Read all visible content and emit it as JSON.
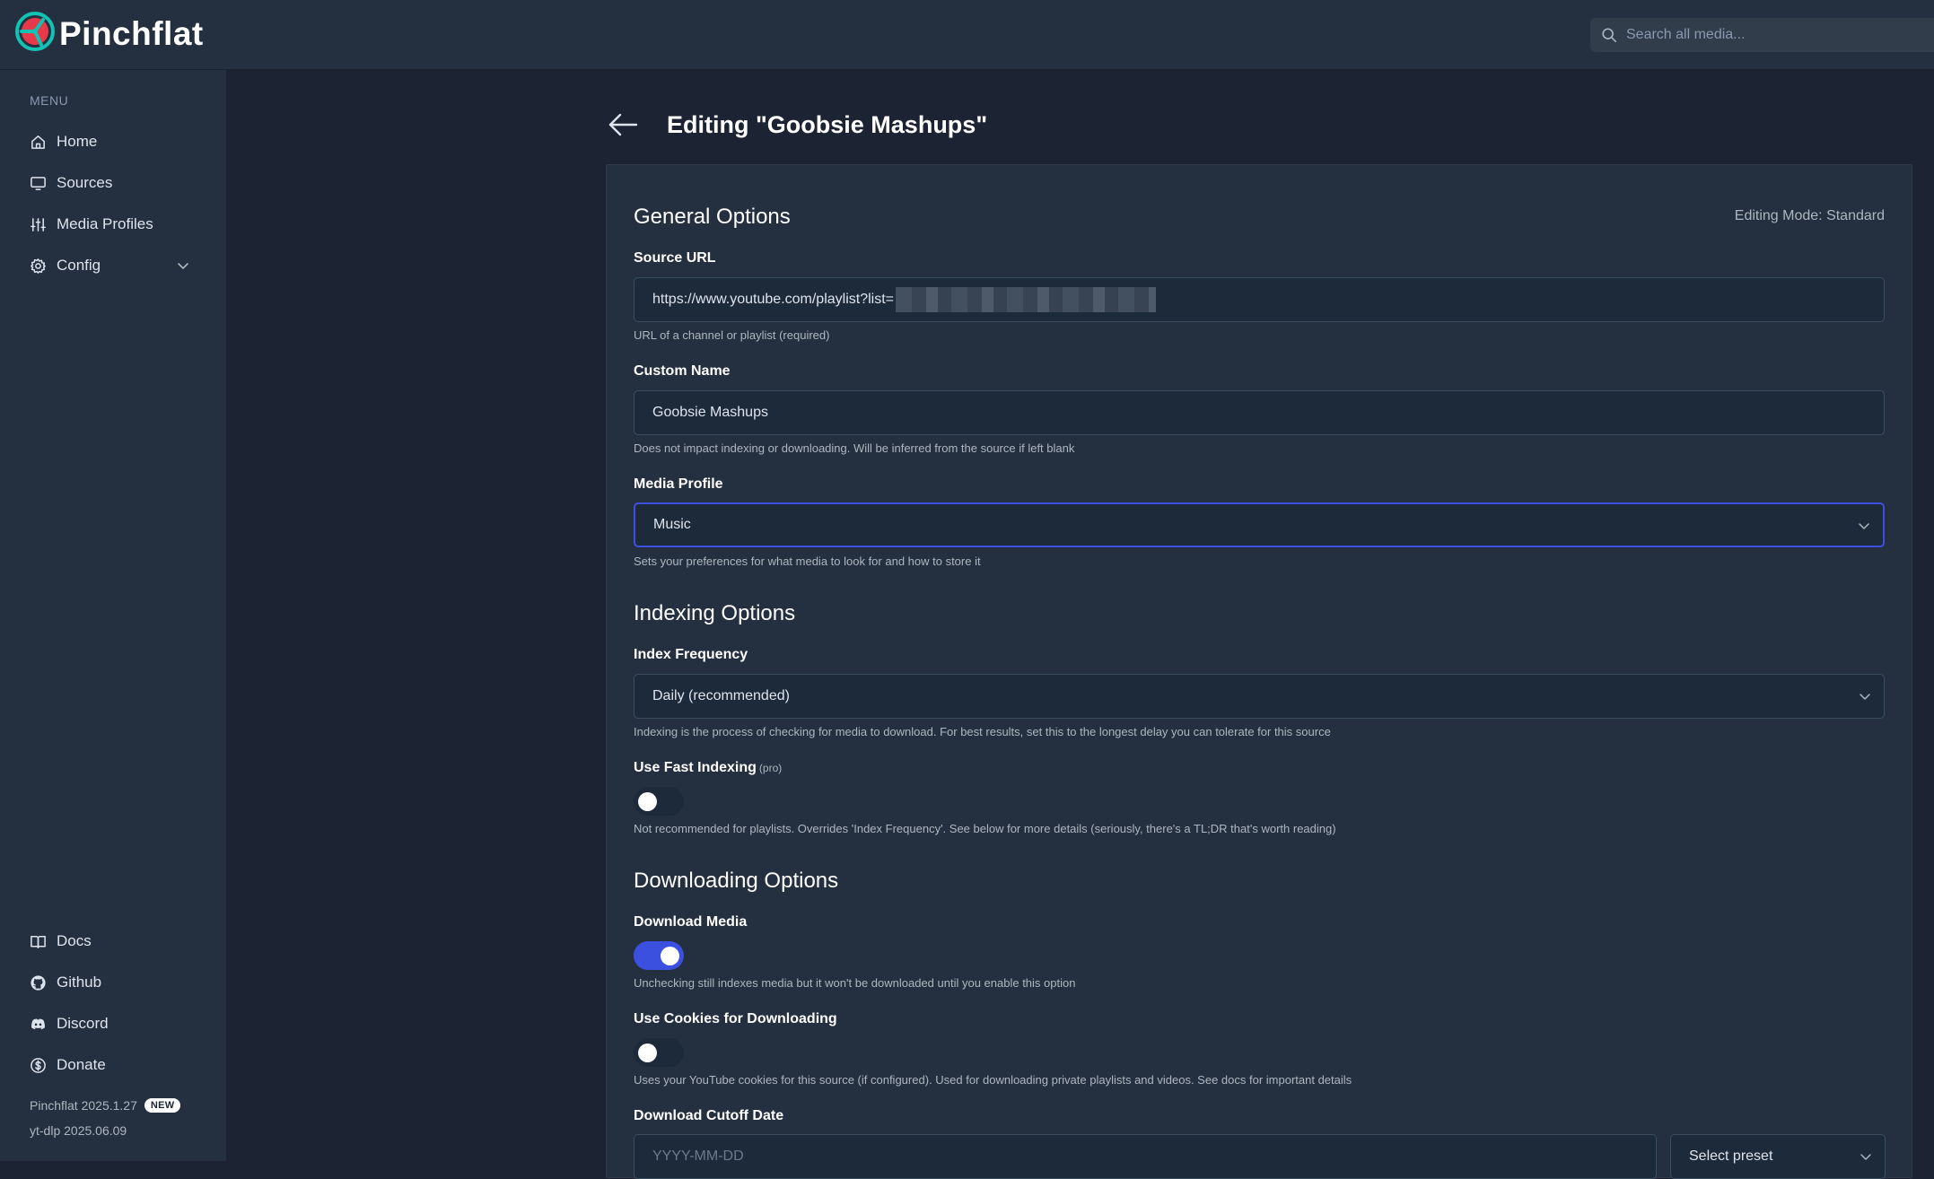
{
  "app": {
    "name": "Pinchflat",
    "search_placeholder": "Search all media..."
  },
  "sidebar": {
    "menu_label": "MENU",
    "items": [
      {
        "label": "Home",
        "icon": "home-icon"
      },
      {
        "label": "Sources",
        "icon": "monitor-icon"
      },
      {
        "label": "Media Profiles",
        "icon": "sliders-icon"
      },
      {
        "label": "Config",
        "icon": "gear-icon"
      }
    ],
    "bottom_items": [
      {
        "label": "Docs",
        "icon": "book-icon"
      },
      {
        "label": "Github",
        "icon": "github-icon"
      },
      {
        "label": "Discord",
        "icon": "discord-icon"
      },
      {
        "label": "Donate",
        "icon": "dollar-icon"
      }
    ],
    "version": "Pinchflat 2025.1.27",
    "new_badge": "NEW",
    "ytdlp_version": "yt-dlp 2025.06.09"
  },
  "page": {
    "title": "Editing \"Goobsie Mashups\""
  },
  "form": {
    "editing_mode": "Editing Mode: Standard",
    "general": {
      "title": "General Options",
      "source_url_label": "Source URL",
      "source_url_value": "https://www.youtube.com/playlist?list=",
      "source_url_hint": "URL of a channel or playlist (required)",
      "custom_name_label": "Custom Name",
      "custom_name_value": "Goobsie Mashups",
      "custom_name_hint": "Does not impact indexing or downloading. Will be inferred from the source if left blank",
      "media_profile_label": "Media Profile",
      "media_profile_value": "Music",
      "media_profile_hint": "Sets your preferences for what media to look for and how to store it"
    },
    "indexing": {
      "title": "Indexing Options",
      "frequency_label": "Index Frequency",
      "frequency_value": "Daily (recommended)",
      "frequency_hint": "Indexing is the process of checking for media to download. For best results, set this to the longest delay you can tolerate for this source",
      "fast_label": "Use Fast Indexing",
      "fast_pro": "(pro)",
      "fast_enabled": false,
      "fast_hint": "Not recommended for playlists. Overrides 'Index Frequency'. See below for more details (seriously, there's a TL;DR that's worth reading)"
    },
    "downloading": {
      "title": "Downloading Options",
      "download_label": "Download Media",
      "download_enabled": true,
      "download_hint": "Unchecking still indexes media but it won't be downloaded until you enable this option",
      "cookies_label": "Use Cookies for Downloading",
      "cookies_enabled": false,
      "cookies_hint": "Uses your YouTube cookies for this source (if configured). Used for downloading private playlists and videos. See docs for important details",
      "cutoff_label": "Download Cutoff Date",
      "cutoff_placeholder": "YYYY-MM-DD",
      "preset_value": "Select preset"
    }
  },
  "colors": {
    "accent": "#3c50e0",
    "background": "#1c2434",
    "panel": "#24303f",
    "input": "#1d2a39"
  }
}
